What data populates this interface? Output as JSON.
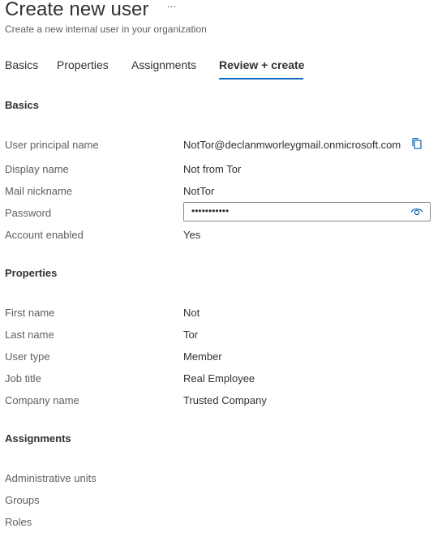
{
  "header": {
    "title": "Create new user",
    "more_label": "⋯",
    "subtitle": "Create a new internal user in your organization"
  },
  "tabs": [
    {
      "label": "Basics",
      "active": false
    },
    {
      "label": "Properties",
      "active": false
    },
    {
      "label": "Assignments",
      "active": false
    },
    {
      "label": "Review + create",
      "active": true
    }
  ],
  "basics": {
    "heading": "Basics",
    "upn_label": "User principal name",
    "upn_value": "NotTor@declanmworleygmail.onmicrosoft.com",
    "display_name_label": "Display name",
    "display_name_value": "Not from Tor",
    "mail_nickname_label": "Mail nickname",
    "mail_nickname_value": "NotTor",
    "password_label": "Password",
    "password_value": "•••••••••••",
    "account_enabled_label": "Account enabled",
    "account_enabled_value": "Yes"
  },
  "properties": {
    "heading": "Properties",
    "first_name_label": "First name",
    "first_name_value": "Not",
    "last_name_label": "Last name",
    "last_name_value": "Tor",
    "user_type_label": "User type",
    "user_type_value": "Member",
    "job_title_label": "Job title",
    "job_title_value": "Real Employee",
    "company_name_label": "Company name",
    "company_name_value": "Trusted Company"
  },
  "assignments": {
    "heading": "Assignments",
    "admin_units_label": "Administrative units",
    "groups_label": "Groups",
    "roles_label": "Roles"
  },
  "icons": {
    "copy": "copy-icon",
    "eye": "eye-icon",
    "more": "more-icon"
  },
  "colors": {
    "accent": "#0f6cbd",
    "text": "#323130",
    "muted": "#605e5c"
  }
}
